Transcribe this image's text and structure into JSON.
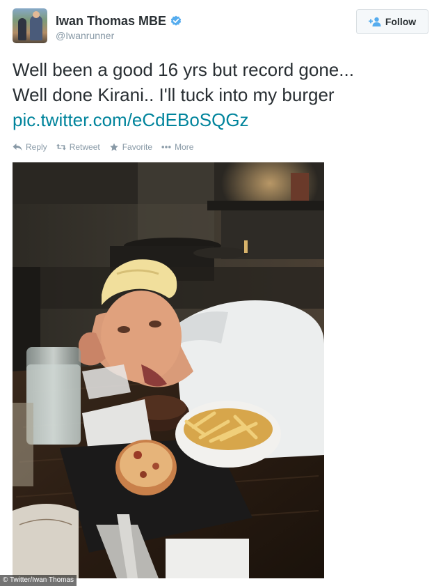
{
  "user": {
    "name": "Iwan Thomas MBE",
    "handle": "@Iwanrunner",
    "verified": true
  },
  "follow_button": {
    "label": "Follow",
    "icon": "add-user-icon"
  },
  "tweet": {
    "text_lines": [
      "Well been a good 16 yrs but record gone...",
      "Well done Kirani.. I'll tuck into my burger"
    ],
    "link": "pic.twitter.com/eCdEBoSQGz"
  },
  "actions": [
    {
      "label": "Reply",
      "icon": "reply-icon"
    },
    {
      "label": "Retweet",
      "icon": "retweet-icon"
    },
    {
      "label": "Favorite",
      "icon": "star-icon"
    },
    {
      "label": "More",
      "icon": "more-dots-icon"
    }
  ],
  "photo": {
    "credit": "© Twitter/Iwan Thomas"
  },
  "colors": {
    "link": "#00849c",
    "verified": "#55acee",
    "muted": "#8899a6",
    "text": "#292f33"
  }
}
